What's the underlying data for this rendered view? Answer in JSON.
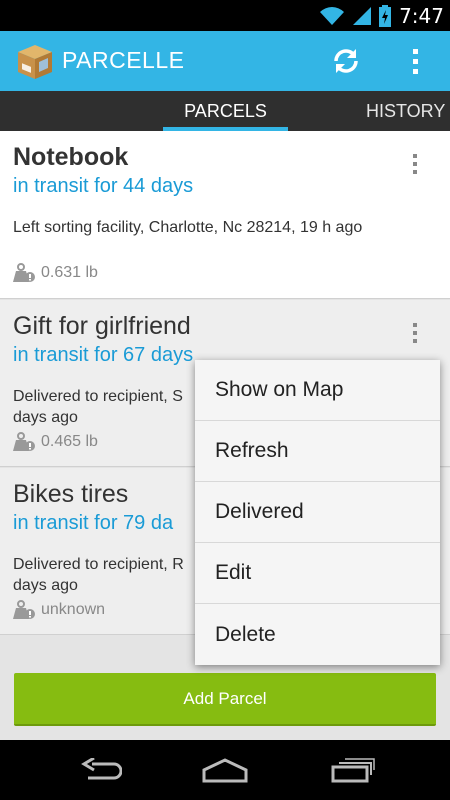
{
  "status_bar": {
    "time": "7:47",
    "icons": [
      "wifi-icon",
      "signal-icon",
      "battery-charging-icon"
    ]
  },
  "action_bar": {
    "title": "PARCELLE",
    "app_icon": "box-icon",
    "actions": [
      "refresh-icon",
      "overflow-menu-icon"
    ],
    "background_color": "#33b5e5"
  },
  "tabs": [
    {
      "label": "PARCELS",
      "selected": true
    },
    {
      "label": "HISTORY",
      "selected": false
    }
  ],
  "parcels": [
    {
      "title": "Notebook",
      "transit": "in transit for 44 days",
      "status": "Left sorting facility, Charlotte, Nc 28214, 19 h ago",
      "weight": "0.631 lb"
    },
    {
      "title": "Gift for girlfriend",
      "transit": "in transit for 67 days",
      "status": "Delivered to recipient, S days ago",
      "weight": "0.465 lb"
    },
    {
      "title": "Bikes tires",
      "transit": "in transit for 79 da",
      "status": "Delivered to recipient, R days ago",
      "weight": "unknown"
    }
  ],
  "popup_menu": {
    "items": [
      "Show on Map",
      "Refresh",
      "Delivered",
      "Edit",
      "Delete"
    ]
  },
  "add_button": {
    "label": "Add Parcel",
    "color": "#86bc11"
  },
  "nav_bar": {
    "buttons": [
      "back-icon",
      "home-icon",
      "recent-apps-icon"
    ]
  },
  "accent_color": "#1a9bd6"
}
